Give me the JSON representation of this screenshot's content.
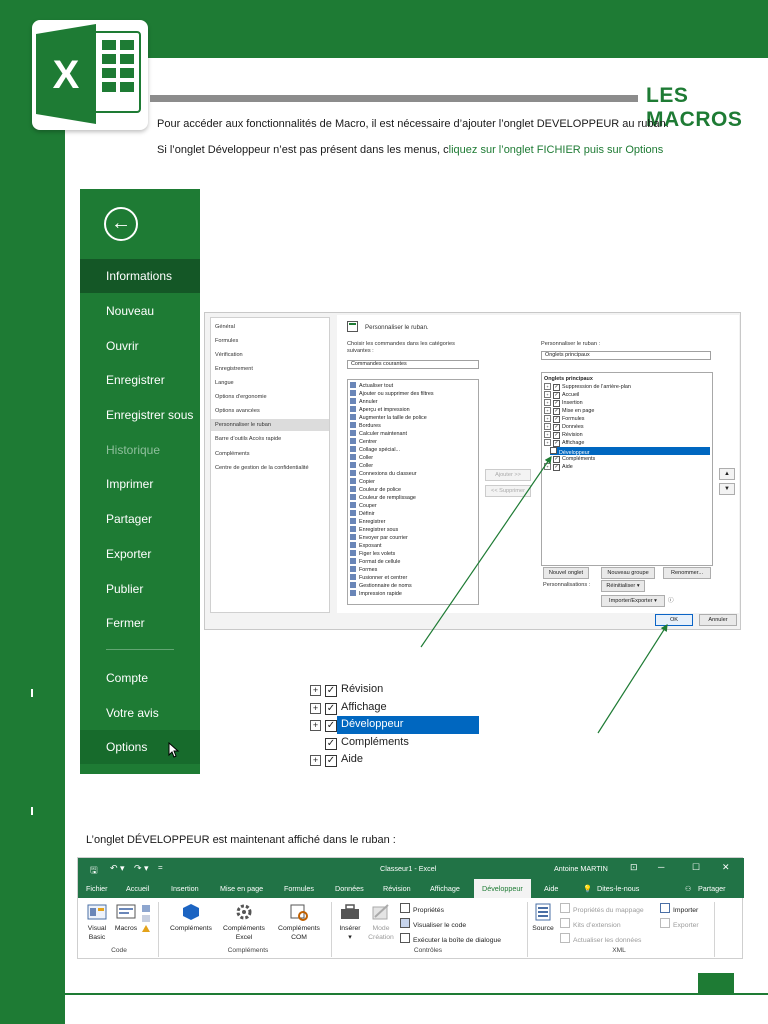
{
  "header": {
    "title": "LES MACROS"
  },
  "intro": {
    "line1": "Pour accéder aux fonctionnalités de Macro, il est nécessaire d’ajouter l’onglet DEVELOPPEUR au ruban.",
    "line2_prefix": "Si l’onglet Développeur n’est pas présent dans les menus, c",
    "line2_link": "liquez sur l’onglet FICHIER puis sur Options"
  },
  "backstage": {
    "items": [
      {
        "label": "Informations"
      },
      {
        "label": "Nouveau"
      },
      {
        "label": "Ouvrir"
      },
      {
        "label": "Enregistrer"
      },
      {
        "label": "Enregistrer sous"
      },
      {
        "label": "Historique"
      },
      {
        "label": "Imprimer"
      },
      {
        "label": "Partager"
      },
      {
        "label": "Exporter"
      },
      {
        "label": "Publier"
      },
      {
        "label": "Fermer"
      },
      {
        "label": "Compte"
      },
      {
        "label": "Votre avis"
      },
      {
        "label": "Options"
      }
    ]
  },
  "dialog": {
    "categories": [
      "Général",
      "Formules",
      "Vérification",
      "Enregistrement",
      "Langue",
      "Options d’ergonomie",
      "Options avancées",
      "Personnaliser le ruban",
      "Barre d’outils Accès rapide",
      "Compléments",
      "Centre de gestion de la confidentialité"
    ],
    "heading": "Personnaliser le ruban.",
    "choose_label": "Choisir les commandes dans les catégories suivantes :",
    "choose_value": "Commandes courantes",
    "customize_label": "Personnaliser le ruban :",
    "customize_value": "Onglets principaux",
    "commands": [
      "Actualiser tout",
      "Ajouter ou supprimer des filtres",
      "Annuler",
      "Aperçu et impression",
      "Augmenter la taille de police",
      "Bordures",
      "Calculer maintenant",
      "Centrer",
      "Collage spécial...",
      "Coller",
      "Coller",
      "Connexions du classeur",
      "Copier",
      "Couleur de police",
      "Couleur de remplissage",
      "Couper",
      "Définir",
      "Enregistrer",
      "Enregistrer sous",
      "Envoyer par courrier",
      "Exposant",
      "Figer les volets",
      "Format de cellule",
      "Formes",
      "Fusionner et centrer",
      "Gestionnaire de noms",
      "Impression rapide"
    ],
    "add_button": "Ajouter >>",
    "remove_button": "<< Supprimer",
    "tabs_header": "Onglets principaux",
    "tabs": [
      "Suppression de l’arrière-plan",
      "Accueil",
      "Insertion",
      "Mise en page",
      "Formules",
      "Données",
      "Révision",
      "Affichage",
      "Développeur",
      "Compléments",
      "Aide"
    ],
    "new_tab_button": "Nouvel onglet",
    "new_group_button": "Nouveau groupe",
    "rename_button": "Renommer...",
    "customizations_label": "Personnalisations :",
    "reset_button": "Réinitialiser ▾",
    "import_export_button": "Importer/Exporter ▾",
    "ok_button": "OK",
    "cancel_button": "Annuler"
  },
  "zoom_list": {
    "items": [
      "Révision",
      "Affichage",
      "Développeur",
      "Compléments",
      "Aide"
    ]
  },
  "caption": "L’onglet DÉVELOPPEUR est maintenant affiché dans le ruban :",
  "ribbon": {
    "doc_title": "Classeur1  -  Excel",
    "user": "Antoine MARTIN",
    "tabs": [
      "Fichier",
      "Accueil",
      "Insertion",
      "Mise en page",
      "Formules",
      "Données",
      "Révision",
      "Affichage",
      "Développeur",
      "Aide",
      "Dites-le-nous",
      "Partager"
    ],
    "groups": {
      "code": "Code",
      "addins": "Compléments",
      "controls": "Contrôles",
      "xml": "XML"
    },
    "buttons": {
      "visual_basic": "Visual Basic",
      "macros": "Macros",
      "addins": "Compléments",
      "excel_addins": "Compléments Excel",
      "com_addins": "Compléments COM",
      "insert": "Insérer",
      "design_mode": "Mode Création",
      "properties": "Propriétés",
      "view_code": "Visualiser le code",
      "run_dialog": "Exécuter la boîte de dialogue",
      "source": "Source",
      "map_props": "Propriétés du mappage",
      "ext_packs": "Kits d’extension",
      "refresh_data": "Actualiser les données",
      "import": "Importer",
      "export": "Exporter"
    }
  },
  "colors": {
    "brand_green": "#1e7b34",
    "excel_green": "#217346",
    "selection_blue": "#0067c0"
  }
}
